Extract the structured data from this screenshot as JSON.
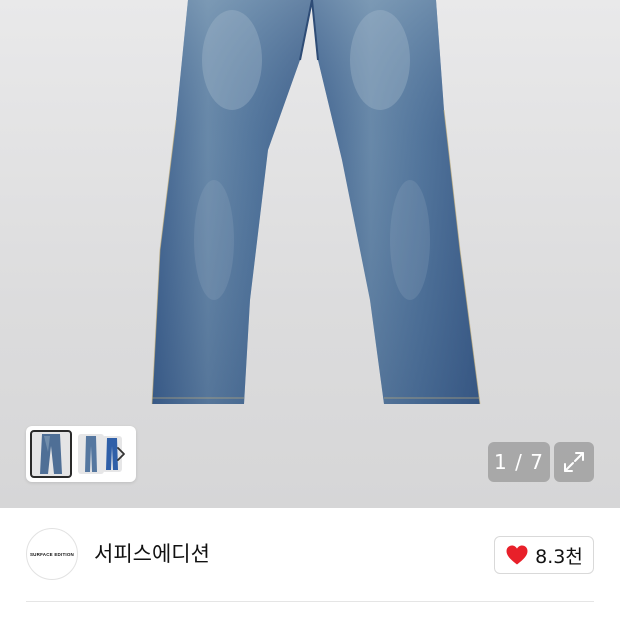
{
  "gallery": {
    "image_alt": "Jeans product photo",
    "counter": "1 / 7",
    "expand_icon": "expand-icon",
    "thumbnails": [
      "jeans-front",
      "jeans-side",
      "jeans-detail"
    ],
    "next_icon": "chevron-right-icon"
  },
  "shop": {
    "logo_text": "SURFACE EDITION",
    "name": "서피스에디션",
    "like_icon": "heart-icon",
    "like_count": "8.3천",
    "like_color": "#e8202a"
  }
}
